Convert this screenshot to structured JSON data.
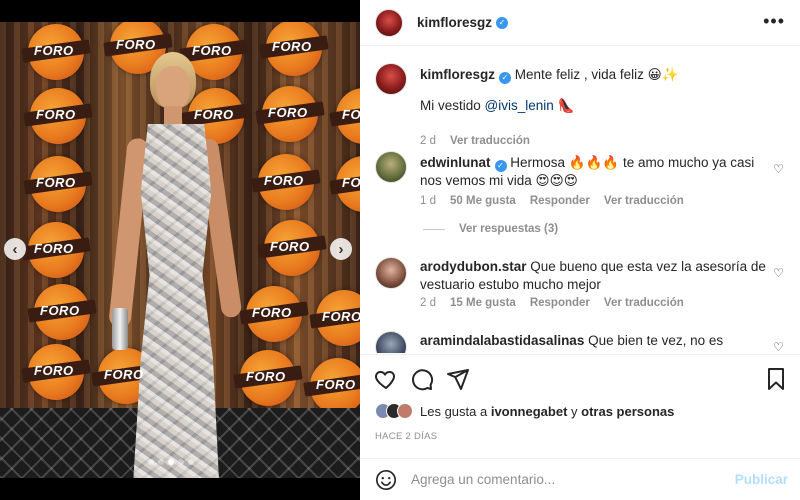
{
  "post": {
    "author": "kimfloresgz",
    "verified_icon": "verified-badge-icon",
    "menu_icon": "more-options-icon",
    "caption_line1": "Mente feliz , vida feliz 😀✨",
    "caption_line2_prefix": "Mi vestido ",
    "caption_mention": "@ivis_lenin",
    "caption_line2_suffix": " 👠",
    "caption_age": "2 d",
    "caption_translate": "Ver traducción"
  },
  "photo": {
    "logo_text": "FORO",
    "carousel_dots": 5,
    "active_dot": 2
  },
  "comments": [
    {
      "user": "edwinlunat",
      "verified": true,
      "text": "Hermosa 🔥🔥🔥 te amo mucho ya casi nos vemos mi vida 😍😍😍",
      "age": "1 d",
      "likes": "50 Me gusta",
      "reply": "Responder",
      "translate": "Ver traducción"
    },
    {
      "user": "arodydubon.star",
      "verified": false,
      "text": "Que bueno que esta vez la asesoría de vestuario estubo mucho mejor",
      "age": "2 d",
      "likes": "15 Me gusta",
      "reply": "Responder",
      "translate": "Ver traducción"
    },
    {
      "user": "aramindalabastidasalinas",
      "verified": false,
      "text": "Que bien te vez, no es necesario"
    }
  ],
  "view_replies": "Ver respuestas (3)",
  "likes_bar": {
    "prefix": "Les gusta a ",
    "user": "ivonnegabet",
    "middle": " y ",
    "others": "otras personas"
  },
  "time_ago": "HACE 2 DÍAS",
  "comment_input": {
    "placeholder": "Agrega un comentario...",
    "publish": "Publicar"
  },
  "colors": {
    "verified": "#3897f0",
    "publish_disabled": "#b2dffc",
    "muted": "#8e8e8e",
    "link": "#00376b"
  }
}
